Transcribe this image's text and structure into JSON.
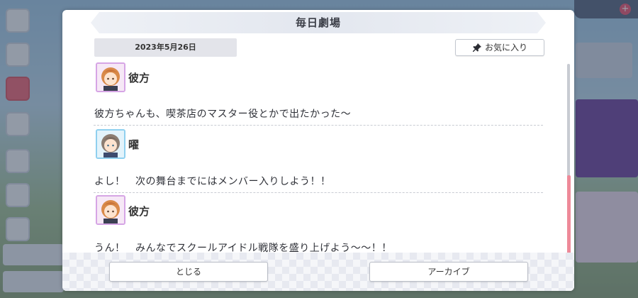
{
  "dialog": {
    "title": "毎日劇場",
    "date": "2023年5月26日",
    "favorite_label": "お気に入り",
    "favorite_icon": "pin-icon"
  },
  "messages": [
    {
      "speaker": "彼方",
      "text": "彼方ちゃんも、喫茶店のマスター役とかで出たかった～",
      "avatar": "kanata-avatar"
    },
    {
      "speaker": "曜",
      "text": "よし！　次の舞台までにはメンバー入りしよう！！",
      "avatar": "you-avatar"
    },
    {
      "speaker": "彼方",
      "text": "うん！　みんなでスクールアイドル戦隊を盛り上げよう～～！！",
      "avatar": "kanata-avatar"
    }
  ],
  "footer": {
    "close_label": "とじる",
    "archive_label": "アーカイブ"
  },
  "colors": {
    "scroll_thumb": "#ee8a99",
    "kanata_frame": "#d6a5e5",
    "you_frame": "#8fd0ef"
  }
}
